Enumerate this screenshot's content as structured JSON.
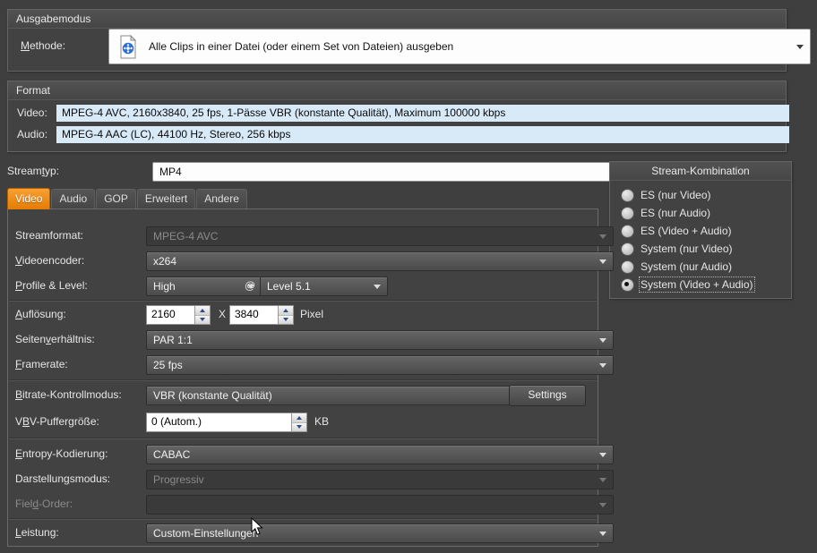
{
  "output_mode": {
    "title": "Ausgabemodus",
    "method_label": "Methode:",
    "method_value": "Alle Clips in einer Datei (oder einem Set von Dateien) ausgeben"
  },
  "format": {
    "title": "Format",
    "video_label": "Video:",
    "video_value": "MPEG-4 AVC, 2160x3840, 25 fps, 1-Pässe VBR (konstante Qualität), Maximum 100000 kbps",
    "audio_label": "Audio:",
    "audio_value": "MPEG-4 AAC (LC), 44100 Hz, Stereo, 256 kbps"
  },
  "streamtype": {
    "label": "Streamtyp:",
    "value": "MP4"
  },
  "stream_combination": {
    "title": "Stream-Kombination",
    "options": [
      {
        "label": "ES (nur Video)"
      },
      {
        "label": "ES (nur Audio)"
      },
      {
        "label": "ES (Video + Audio)"
      },
      {
        "label": "System (nur Video)"
      },
      {
        "label": "System (nur Audio)"
      },
      {
        "label": "System (Video + Audio)"
      }
    ],
    "selected_index": 5
  },
  "tabs": [
    {
      "label": "Video"
    },
    {
      "label": "Audio"
    },
    {
      "label": "GOP"
    },
    {
      "label": "Erweitert"
    },
    {
      "label": "Andere"
    }
  ],
  "active_tab": "Video",
  "video_tab": {
    "streamformat_label": "Streamformat:",
    "streamformat_value": "MPEG-4 AVC",
    "encoder_label": "Videoencoder:",
    "encoder_value": "x264",
    "profile_label": "Profile & Level:",
    "profile_value": "High",
    "at_symbol": "@",
    "level_value": "Level 5.1",
    "resolution_label": "Auflösung:",
    "resolution_width": "2160",
    "resolution_sep": "X",
    "resolution_height": "3840",
    "resolution_unit": "Pixel",
    "aspect_label": "Seitenverhältnis:",
    "aspect_value": "PAR 1:1",
    "framerate_label": "Framerate:",
    "framerate_value": "25 fps",
    "bitrate_label": "Bitrate-Kontrollmodus:",
    "bitrate_value": "VBR (konstante Qualität)",
    "settings_button": "Settings",
    "vbv_label": "VBV-Puffergröße:",
    "vbv_value": "0 (Autom.)",
    "vbv_unit": "KB",
    "entropy_label": "Entropy-Kodierung:",
    "entropy_value": "CABAC",
    "display_label": "Darstellungsmodus:",
    "display_value": "Progressiv",
    "fieldorder_label": "Field-Order:",
    "fieldorder_value": "",
    "performance_label": "Leistung:",
    "performance_value": "Custom-Einstellungen"
  },
  "colors": {
    "accent_tab": "#ef8a1d",
    "field_blue": "#d8e9f8",
    "window_bg": "#3f3f3f"
  }
}
